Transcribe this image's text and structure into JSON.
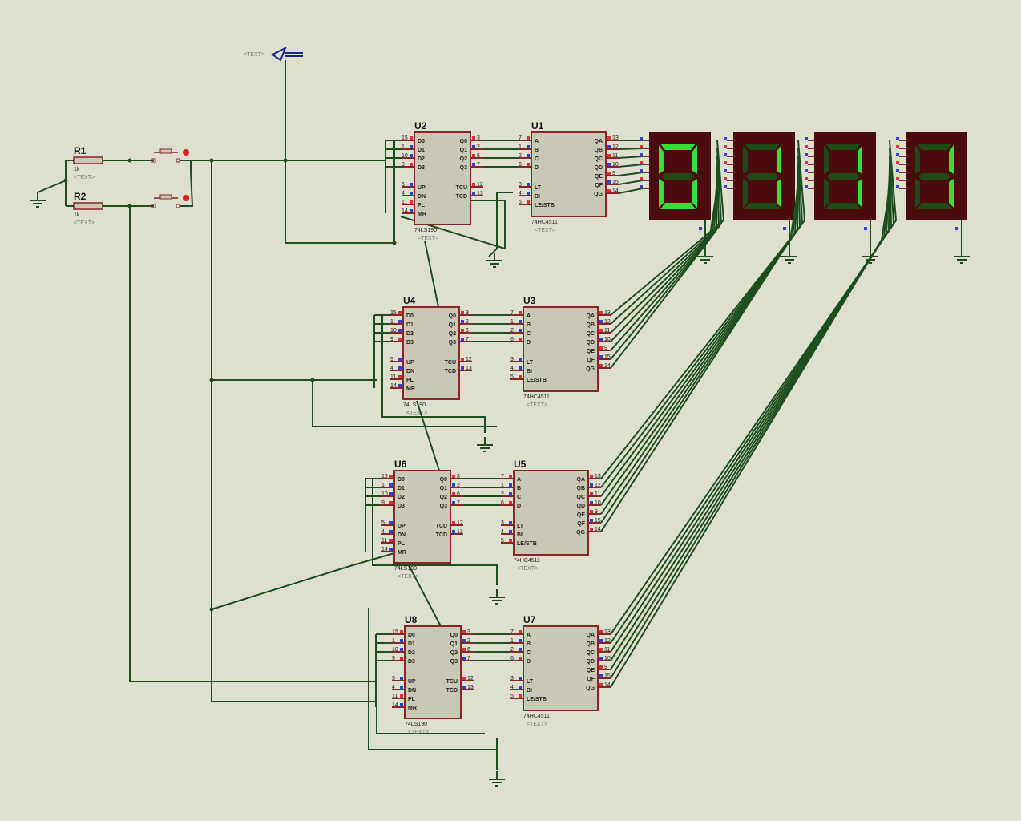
{
  "colors": {
    "background": "#dfdfd0",
    "wire": "#1d4f1d",
    "chip_fill": "#c9c8b5",
    "chip_border": "#8a2525",
    "display_body": "#4a0c0c",
    "segment_on": "#33e033",
    "segment_off": "#1f4a18",
    "pin_high": "#e03030",
    "pin_low": "#3040e0"
  },
  "placeholder_text": "<TEXT>",
  "power_terminal": {
    "icon": "power-terminal-icon"
  },
  "resistors": [
    {
      "ref": "R1",
      "value": "1k"
    },
    {
      "ref": "R2",
      "value": "1k"
    }
  ],
  "counter_pins": {
    "left": [
      [
        "D0",
        "15"
      ],
      [
        "D1",
        "1"
      ],
      [
        "D2",
        "10"
      ],
      [
        "D3",
        "9"
      ],
      [
        "UP",
        "5"
      ],
      [
        "DN",
        "4"
      ],
      [
        "PL",
        "11"
      ],
      [
        "MR",
        "14"
      ]
    ],
    "right": [
      [
        "Q0",
        "3"
      ],
      [
        "Q1",
        "2"
      ],
      [
        "Q2",
        "6"
      ],
      [
        "Q3",
        "7"
      ],
      [
        "TCU",
        "12"
      ],
      [
        "TCD",
        "13"
      ]
    ]
  },
  "decoder_pins": {
    "left": [
      [
        "A",
        "7"
      ],
      [
        "B",
        "1"
      ],
      [
        "C",
        "2"
      ],
      [
        "D",
        "6"
      ],
      [
        "LT",
        "3"
      ],
      [
        "BI",
        "4"
      ],
      [
        "LE/STB",
        "5"
      ]
    ],
    "right": [
      [
        "QA",
        "13"
      ],
      [
        "QB",
        "12"
      ],
      [
        "QC",
        "11"
      ],
      [
        "QD",
        "10"
      ],
      [
        "QE",
        "9"
      ],
      [
        "QF",
        "15"
      ],
      [
        "QG",
        "14"
      ]
    ]
  },
  "counters": [
    {
      "ref": "U2",
      "part": "74LS190"
    },
    {
      "ref": "U4",
      "part": "74LS190"
    },
    {
      "ref": "U6",
      "part": "74LS190"
    },
    {
      "ref": "U8",
      "part": "74LS190"
    }
  ],
  "decoders": [
    {
      "ref": "U1",
      "part": "74HC4511"
    },
    {
      "ref": "U3",
      "part": "74HC4511"
    },
    {
      "ref": "U5",
      "part": "74HC4511"
    },
    {
      "ref": "U7",
      "part": "74HC4511"
    }
  ],
  "displays": [
    {
      "digit": 0
    },
    {
      "digit": 1
    },
    {
      "digit": 1
    },
    {
      "digit": 1
    }
  ]
}
